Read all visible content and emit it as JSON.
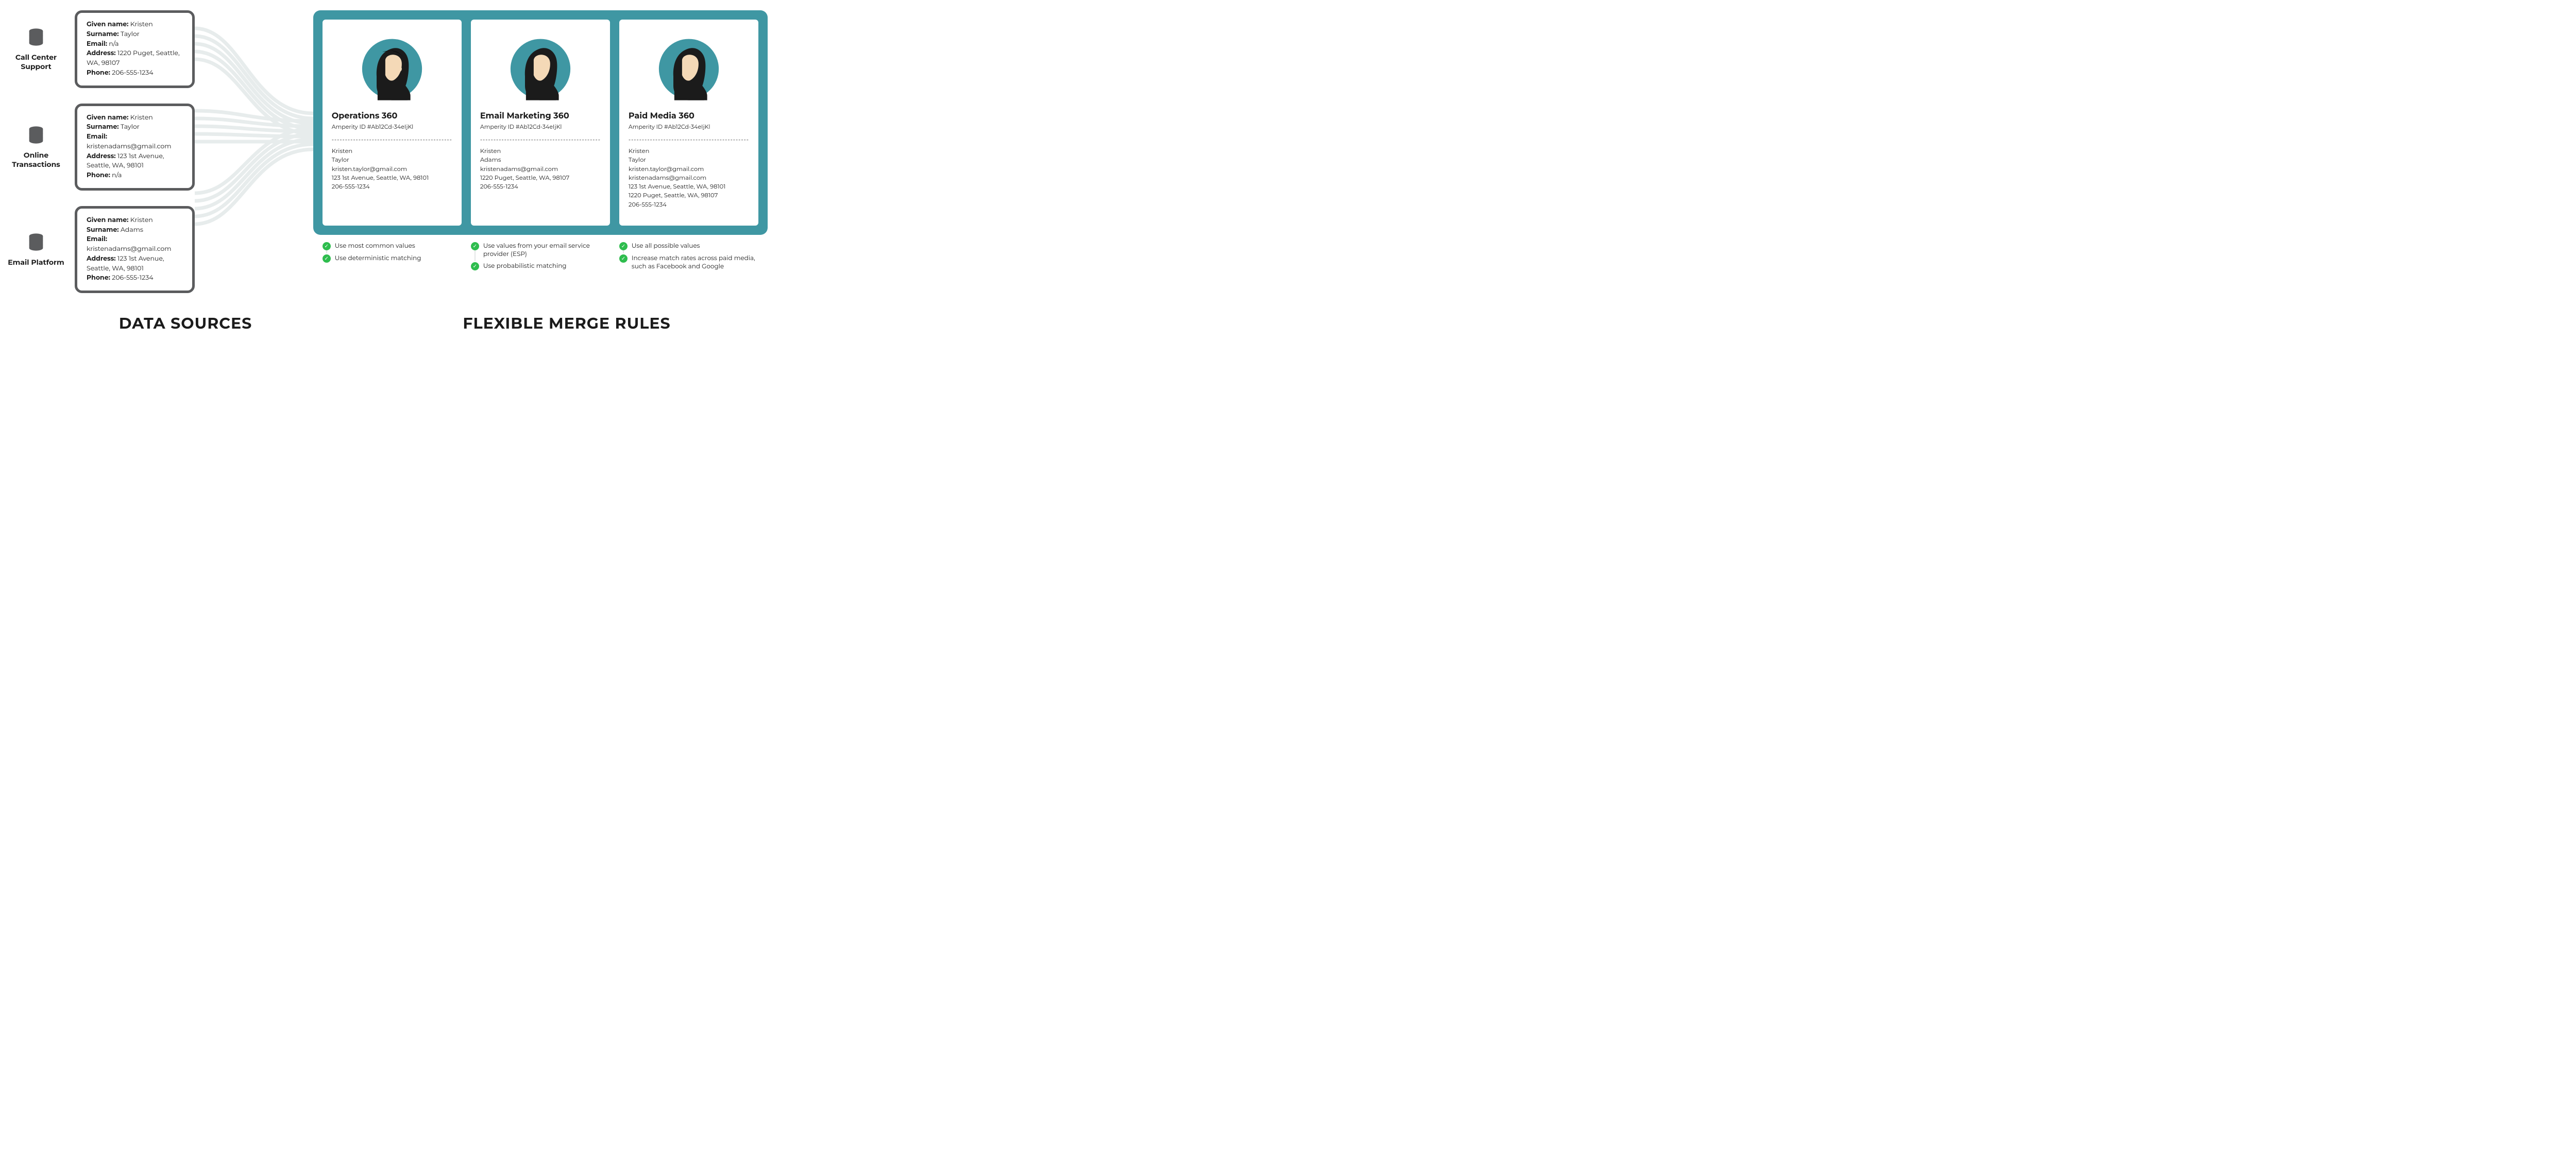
{
  "footer": {
    "left": "DATA SOURCES",
    "right": "FLEXIBLE MERGE RULES"
  },
  "amperity_id_label": "Amperity ID #Ab12Cd-34eIjKl",
  "dashes": "---------------------------------------------",
  "sources": [
    {
      "label": "Call Center Support",
      "given": "Kristen",
      "surname": "Taylor",
      "email": "n/a",
      "address": "1220 Puget, Seattle, WA, 98107",
      "phone": "206-555-1234"
    },
    {
      "label": "Online Transactions",
      "given": "Kristen",
      "surname": "Taylor",
      "email": "kristenadams@gmail.com",
      "address": "123 1st Avenue, Seattle, WA, 98101",
      "phone": "n/a"
    },
    {
      "label": "Email Platform",
      "given": "Kristen",
      "surname": "Adams",
      "email": "kristenadams@gmail.com",
      "address": "123 1st Avenue, Seattle, WA, 98101",
      "phone": "206-555-1234"
    }
  ],
  "profiles": [
    {
      "title": "Operations 360",
      "fields": [
        "Kristen",
        "Taylor",
        "kristen.taylor@gmail.com",
        "123 1st Avenue, Seattle, WA, 98101",
        "206-555-1234"
      ],
      "rules": [
        "Use most common values",
        "Use deterministic matching"
      ]
    },
    {
      "title": "Email Marketing 360",
      "fields": [
        "Kristen",
        "Adams",
        "kristenadams@gmail.com",
        "1220 Puget, Seattle, WA, 98107",
        "206-555-1234"
      ],
      "rules": [
        "Use values from your email service provider (ESP)",
        "Use probabilistic matching"
      ]
    },
    {
      "title": "Paid Media 360",
      "fields": [
        "Kristen",
        "Taylor",
        "kristen.taylor@gmail.com",
        "kristenadams@gmail.com",
        "123 1st Avenue, Seattle, WA, 98101",
        "1220 Puget, Seattle, WA, 98107",
        "206-555-1234"
      ],
      "rules": [
        "Use all possible values",
        "Increase match rates across paid media, such as Facebook and Google"
      ]
    }
  ],
  "field_labels": {
    "given": "Given name:",
    "surname": "Surname:",
    "email": "Email:",
    "address": "Address:",
    "phone": "Phone:"
  }
}
